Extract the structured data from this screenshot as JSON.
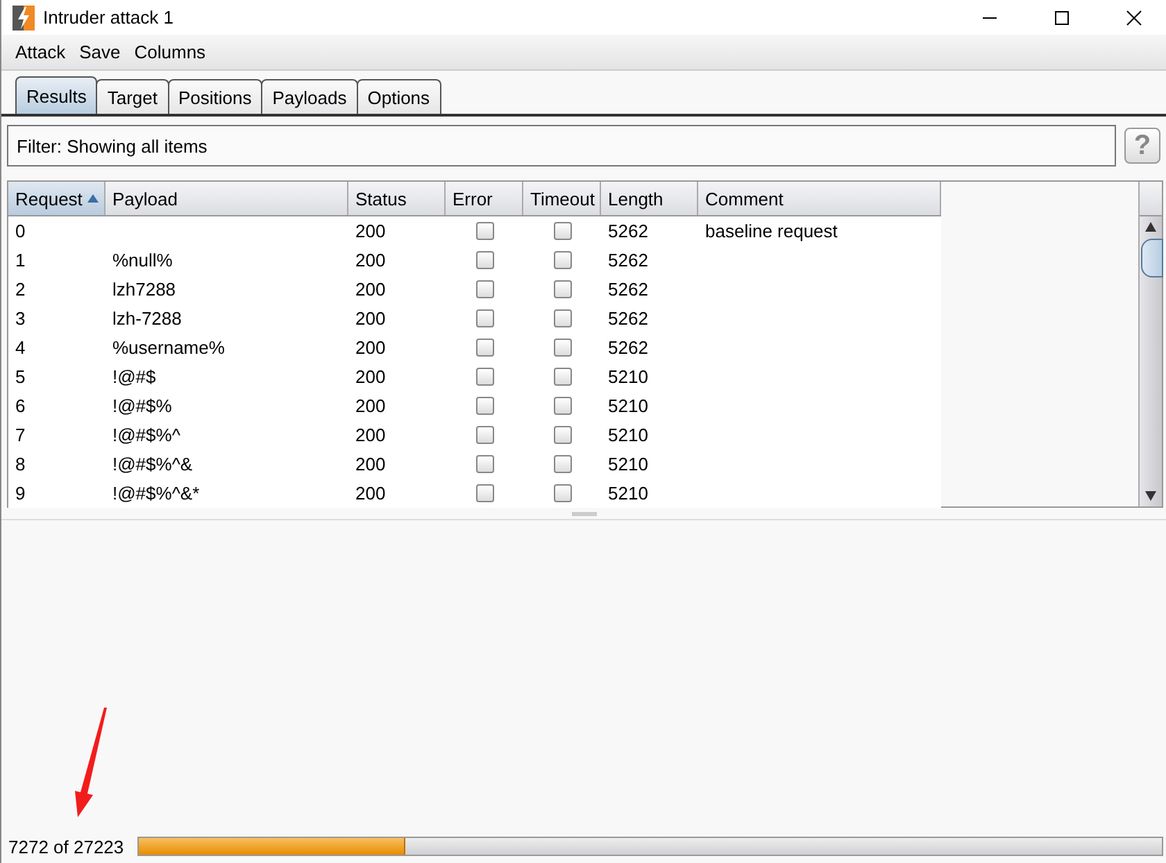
{
  "window": {
    "title": "Intruder attack 1"
  },
  "menu": [
    "Attack",
    "Save",
    "Columns"
  ],
  "tabs": [
    {
      "label": "Results",
      "selected": true
    },
    {
      "label": "Target",
      "selected": false
    },
    {
      "label": "Positions",
      "selected": false
    },
    {
      "label": "Payloads",
      "selected": false
    },
    {
      "label": "Options",
      "selected": false
    }
  ],
  "filter": {
    "text": "Filter: Showing all items",
    "help": "?"
  },
  "table": {
    "columns": [
      {
        "label": "Request",
        "sorted": true
      },
      {
        "label": "Payload",
        "sorted": false
      },
      {
        "label": "Status",
        "sorted": false
      },
      {
        "label": "Error",
        "sorted": false
      },
      {
        "label": "Timeout",
        "sorted": false
      },
      {
        "label": "Length",
        "sorted": false
      },
      {
        "label": "Comment",
        "sorted": false
      }
    ],
    "rows": [
      {
        "request": "0",
        "payload": "",
        "status": "200",
        "error": false,
        "timeout": false,
        "length": "5262",
        "comment": "baseline request"
      },
      {
        "request": "1",
        "payload": "%null%",
        "status": "200",
        "error": false,
        "timeout": false,
        "length": "5262",
        "comment": ""
      },
      {
        "request": "2",
        "payload": "lzh7288",
        "status": "200",
        "error": false,
        "timeout": false,
        "length": "5262",
        "comment": ""
      },
      {
        "request": "3",
        "payload": "lzh-7288",
        "status": "200",
        "error": false,
        "timeout": false,
        "length": "5262",
        "comment": ""
      },
      {
        "request": "4",
        "payload": "%username%",
        "status": "200",
        "error": false,
        "timeout": false,
        "length": "5262",
        "comment": ""
      },
      {
        "request": "5",
        "payload": "!@#$",
        "status": "200",
        "error": false,
        "timeout": false,
        "length": "5210",
        "comment": ""
      },
      {
        "request": "6",
        "payload": "!@#$%",
        "status": "200",
        "error": false,
        "timeout": false,
        "length": "5210",
        "comment": ""
      },
      {
        "request": "7",
        "payload": "!@#$%^",
        "status": "200",
        "error": false,
        "timeout": false,
        "length": "5210",
        "comment": ""
      },
      {
        "request": "8",
        "payload": "!@#$%^&",
        "status": "200",
        "error": false,
        "timeout": false,
        "length": "5210",
        "comment": ""
      },
      {
        "request": "9",
        "payload": "!@#$%^&*",
        "status": "200",
        "error": false,
        "timeout": false,
        "length": "5210",
        "comment": ""
      }
    ]
  },
  "status_bar": {
    "progress_text": "7272 of 27223",
    "level": 0.26
  }
}
